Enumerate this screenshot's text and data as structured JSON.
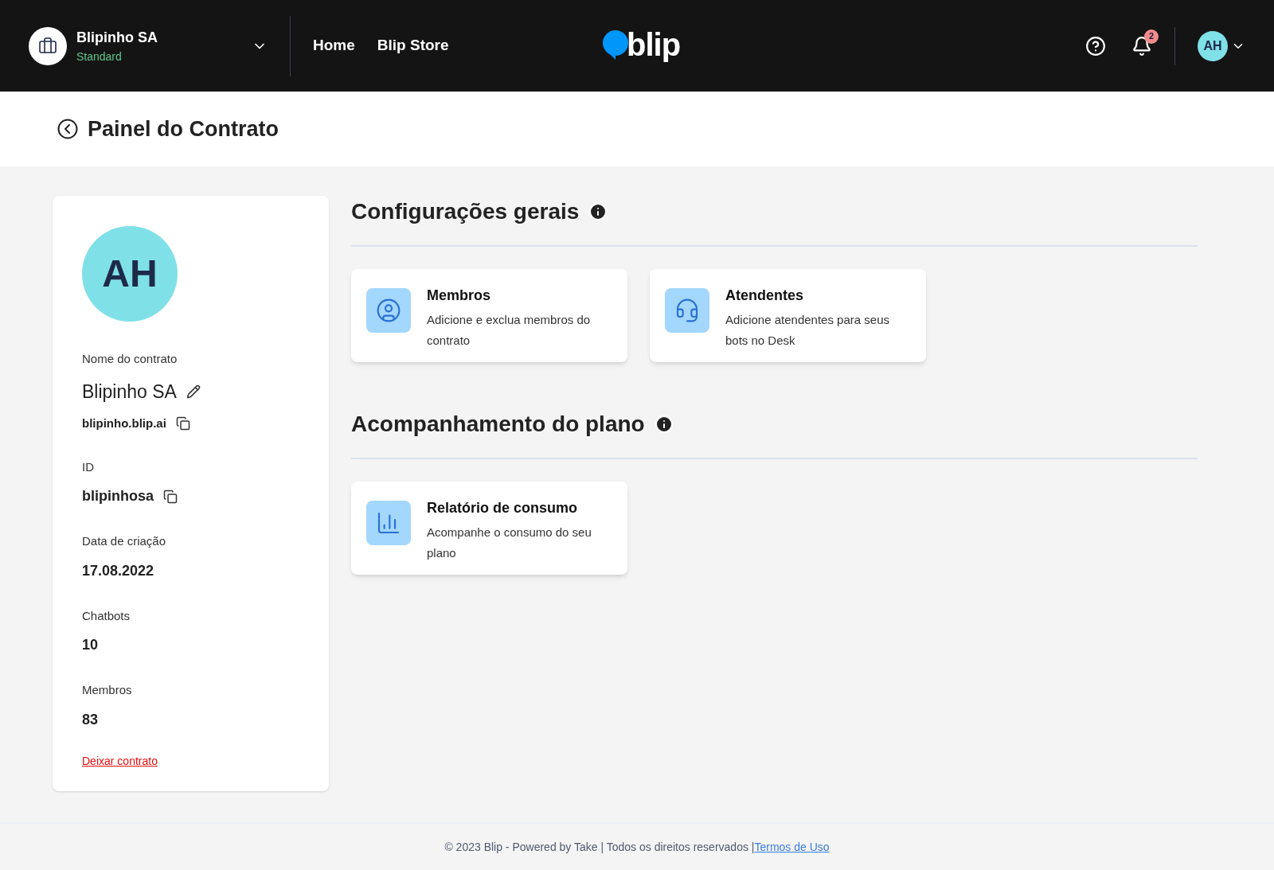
{
  "header": {
    "workspace": {
      "name": "Blipinho SA",
      "plan": "Standard"
    },
    "nav": [
      {
        "label": "Home"
      },
      {
        "label": "Blip Store"
      }
    ],
    "logo": "blip",
    "notifications": "2",
    "user_initials": "AH"
  },
  "page_title": "Painel do Contrato",
  "contract": {
    "avatar_initials": "AH",
    "fields": [
      {
        "kind": "name",
        "label": "Nome do contrato",
        "value": "Blipinho SA",
        "subvalue": "blipinho.blip.ai"
      },
      {
        "kind": "copy",
        "label": "ID",
        "value": "blipinhosa"
      },
      {
        "kind": "plain",
        "label": "Data de criação",
        "value": "17.08.2022"
      },
      {
        "kind": "plain",
        "label": "Chatbots",
        "value": "10"
      },
      {
        "kind": "plain",
        "label": "Membros",
        "value": "83"
      }
    ],
    "leave_link": "Deixar contrato"
  },
  "sections": [
    {
      "title": "Configurações gerais",
      "cards": [
        {
          "kind": "user",
          "title": "Membros",
          "description": "Adicione e exclua membros do contrato"
        },
        {
          "kind": "headset",
          "title": "Atendentes",
          "description": "Adicione atendentes para seus bots no Desk"
        }
      ]
    },
    {
      "title": "Acompanhamento do plano",
      "cards": [
        {
          "kind": "chart",
          "title": "Relatório de consumo",
          "description": "Acompanhe o consumo do seu plano"
        }
      ]
    }
  ],
  "footer": {
    "text": "© 2023 Blip - Powered by Take | Todos os direitos reservados |",
    "link": "Termos de Uso"
  }
}
